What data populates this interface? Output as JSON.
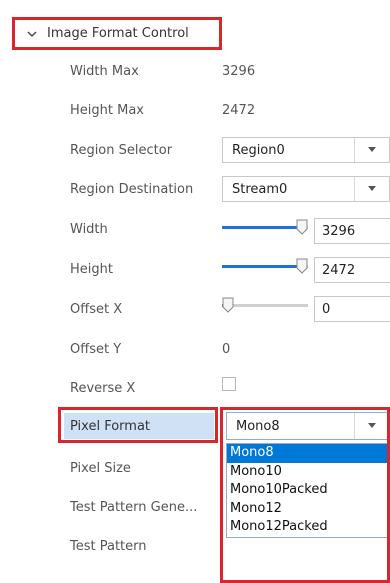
{
  "section": {
    "title": "Image Format Control",
    "icon": "chevron-down-icon"
  },
  "rows": {
    "width_max": {
      "label": "Width Max",
      "value": "3296"
    },
    "height_max": {
      "label": "Height Max",
      "value": "2472"
    },
    "region_selector": {
      "label": "Region Selector",
      "value": "Region0"
    },
    "region_destination": {
      "label": "Region Destination",
      "value": "Stream0"
    },
    "width": {
      "label": "Width",
      "value": "3296",
      "slider_fraction": 1.0
    },
    "height": {
      "label": "Height",
      "value": "2472",
      "slider_fraction": 1.0
    },
    "offset_x": {
      "label": "Offset X",
      "value": "0",
      "slider_fraction": 0.0
    },
    "offset_y": {
      "label": "Offset Y",
      "value": "0"
    },
    "reverse_x": {
      "label": "Reverse X",
      "checked": false
    },
    "pixel_format": {
      "label": "Pixel Format",
      "value": "Mono8",
      "options": [
        "Mono8",
        "Mono10",
        "Mono10Packed",
        "Mono12",
        "Mono12Packed"
      ],
      "selected_index": 0
    },
    "pixel_size": {
      "label": "Pixel Size"
    },
    "test_pattern_gen": {
      "label": "Test Pattern Gene..."
    },
    "test_pattern": {
      "label": "Test Pattern"
    }
  },
  "colors": {
    "accent": "#1e73d2",
    "highlight_border": "#d9262c",
    "selected_bg": "#0078d7",
    "label_highlight": "#cfe1f5"
  }
}
